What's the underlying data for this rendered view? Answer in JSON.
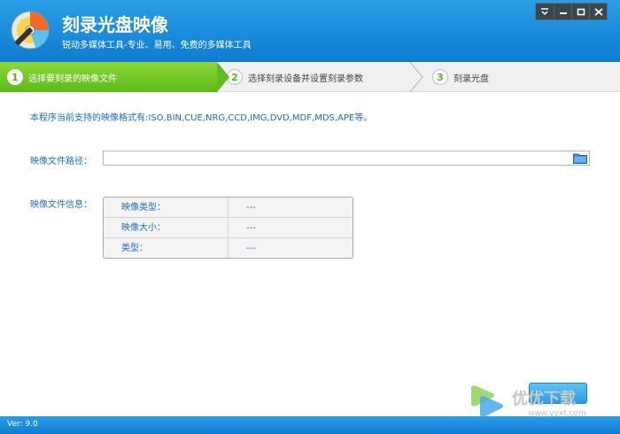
{
  "header": {
    "title": "刻录光盘映像",
    "subtitle": "锐动多媒体工具-专业、易用、免费的多媒体工具"
  },
  "window_controls": [
    "menu-icon",
    "minimize-icon",
    "maximize-icon",
    "close-icon"
  ],
  "steps": [
    {
      "num": "1",
      "label": "选择要刻录的映像文件"
    },
    {
      "num": "2",
      "label": "选择刻录设备并设置刻录参数"
    },
    {
      "num": "3",
      "label": "刻录光盘"
    }
  ],
  "main": {
    "supported_formats": "本程序当前支持的映像格式有:ISO,BIN,CUE,NRG,CCD,IMG,DVD,MDF,MDS,APE等。",
    "path_label": "映像文件路径：",
    "path_value": "",
    "info_label": "映像文件信息：",
    "info_rows": [
      {
        "key": "映像类型：",
        "value": "---"
      },
      {
        "key": "映像大小：",
        "value": "---"
      },
      {
        "key": "类型：",
        "value": "---"
      }
    ]
  },
  "footer": {
    "version": "Ver: 9.0"
  },
  "watermark": {
    "text": "优优下载",
    "url": "www.yyxt.com"
  },
  "colors": {
    "accent": "#1a8ee0",
    "step_active": "#6cc024",
    "text_blue": "#1a6fc4"
  }
}
